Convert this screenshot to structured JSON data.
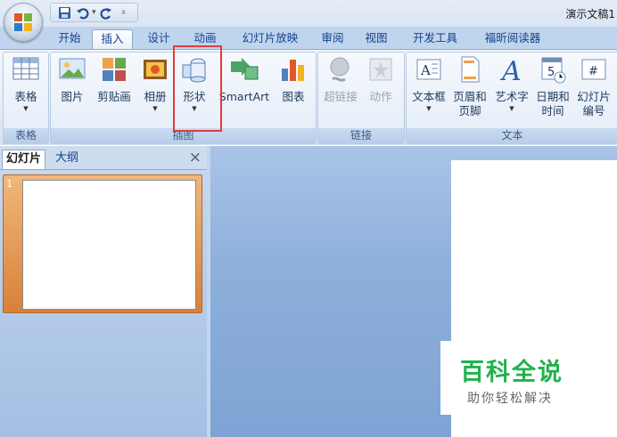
{
  "title_bar": {
    "title": "演示文稿1"
  },
  "quick_access": {
    "save": "save-icon",
    "undo": "undo-icon",
    "redo": "redo-icon",
    "customize": "customize-icon"
  },
  "tabs": [
    "开始",
    "插入",
    "设计",
    "动画",
    "幻灯片放映",
    "审阅",
    "视图",
    "开发工具",
    "福昕阅读器"
  ],
  "active_tab": "插入",
  "ribbon": {
    "groups": [
      {
        "label": "表格",
        "buttons": [
          {
            "label": "表格",
            "dropdown": true,
            "icon": "table-icon"
          }
        ]
      },
      {
        "label": "插图",
        "buttons": [
          {
            "label": "图片",
            "icon": "picture-icon"
          },
          {
            "label": "剪贴画",
            "icon": "clipart-icon"
          },
          {
            "label": "相册",
            "dropdown": true,
            "icon": "photo-album-icon"
          },
          {
            "label": "形状",
            "dropdown": true,
            "icon": "shapes-icon",
            "highlighted": true
          },
          {
            "label": "SmartArt",
            "icon": "smartart-icon"
          },
          {
            "label": "图表",
            "icon": "chart-icon"
          }
        ]
      },
      {
        "label": "链接",
        "buttons": [
          {
            "label": "超链接",
            "icon": "hyperlink-icon",
            "disabled": true
          },
          {
            "label": "动作",
            "icon": "action-icon",
            "disabled": true
          }
        ]
      },
      {
        "label": "文本",
        "buttons": [
          {
            "label": "文本框",
            "dropdown": true,
            "icon": "textbox-icon"
          },
          {
            "label": "页眉和",
            "label2": "页脚",
            "icon": "header-footer-icon"
          },
          {
            "label": "艺术字",
            "dropdown": true,
            "icon": "wordart-icon"
          },
          {
            "label": "日期和",
            "label2": "时间",
            "icon": "date-time-icon"
          },
          {
            "label": "幻灯片",
            "label2": "编号",
            "icon": "slide-number-icon"
          }
        ]
      }
    ]
  },
  "pane": {
    "tabs": [
      "幻灯片",
      "大纲"
    ],
    "close": "×",
    "slide_number": "1"
  },
  "watermark": {
    "title": "百科全说",
    "subtitle": "助你轻松解决"
  },
  "colors": {
    "accent": "#15428b",
    "highlight": "#e23b3b",
    "watermark_green": "#22b14c",
    "thumbnail_selected": "#e79a52"
  }
}
